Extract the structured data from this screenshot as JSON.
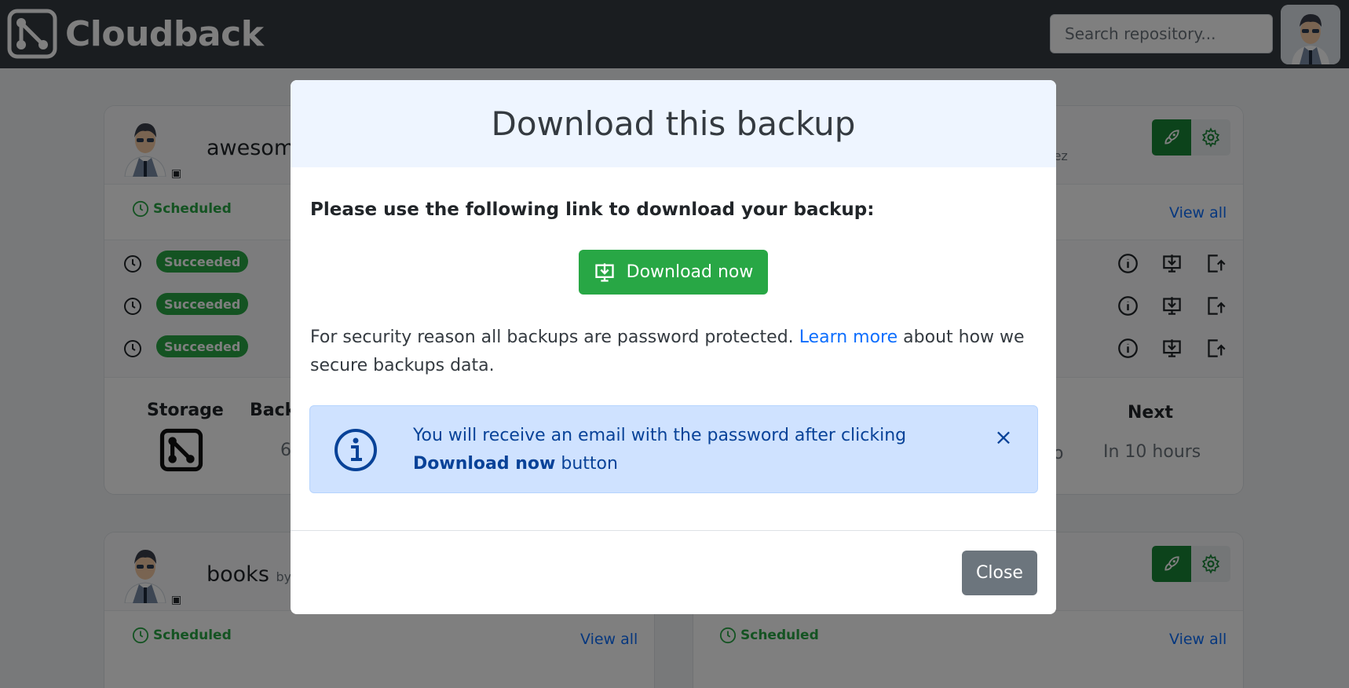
{
  "navbar": {
    "brand": "Cloudback",
    "search_placeholder": "Search repository..."
  },
  "cards": [
    {
      "repo_name": "awesome",
      "owner_tail": "inez",
      "schedule_status": "Scheduled",
      "view_all": "View all",
      "runs": [
        "Succeeded",
        "Succeeded",
        "Succeeded"
      ],
      "stats": {
        "storage_label": "Storage",
        "backups_label": "Back",
        "backups_value": "6",
        "next_label": "Next",
        "next_value": "In 10 hours",
        "partial_value": "o"
      }
    },
    {
      "repo_name": "books",
      "owner_prefix": "by",
      "schedule_status": "Scheduled",
      "view_all": "View all"
    },
    {
      "schedule_status": "Scheduled",
      "view_all": "View all"
    }
  ],
  "modal": {
    "title": "Download this backup",
    "lead": "Please use the following link to download your backup:",
    "download_button": "Download now",
    "security_text_before": "For security reason all backups are password protected.",
    "learn_more": "Learn more",
    "security_text_after": "about how we secure backups data.",
    "alert_text": "You will receive an email with the password after clicking",
    "alert_bold": "Download now",
    "alert_tail": "button",
    "alert_close": "×",
    "close_button": "Close"
  },
  "colors": {
    "navbar": "#343a40",
    "success": "#28a745",
    "primary_link": "#0d6efd",
    "alert_bg": "#cfe2ff",
    "alert_text": "#084298",
    "modal_header": "#eef5ff",
    "close_button": "#6c757d"
  }
}
